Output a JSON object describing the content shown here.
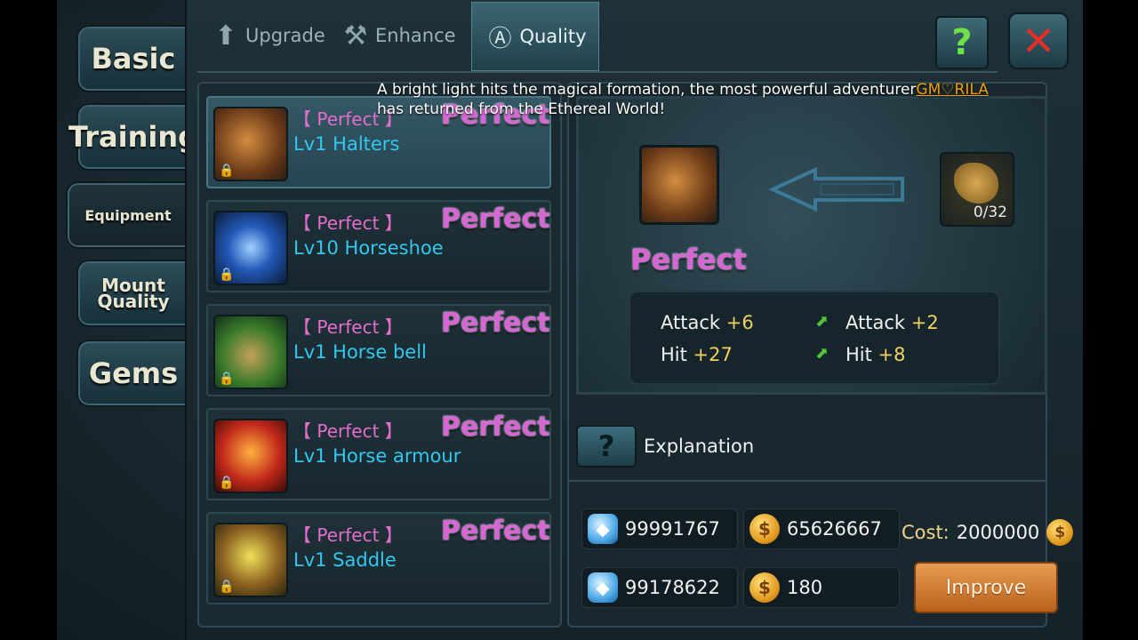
{
  "side_tabs": [
    {
      "label": "Basic"
    },
    {
      "label": "Training"
    },
    {
      "label": "Equipment"
    },
    {
      "label": "Mount Quality"
    },
    {
      "label": "Gems"
    }
  ],
  "top_tabs": [
    {
      "label": "Upgrade"
    },
    {
      "label": "Enhance"
    },
    {
      "label": "Quality"
    }
  ],
  "help_symbol": "?",
  "close_symbol": "✕",
  "announcement": {
    "prefix": "A bright light hits the magical formation, the most powerful adventurer",
    "player": "GM♡RILA",
    "suffix": " has returned from the Ethereal World!"
  },
  "items": [
    {
      "tag": "【 Perfect 】",
      "grade": "Perfect",
      "name": "Lv1 Halters"
    },
    {
      "tag": "【 Perfect 】",
      "grade": "Perfect",
      "name": "Lv10 Horseshoe"
    },
    {
      "tag": "【 Perfect 】",
      "grade": "Perfect",
      "name": "Lv1 Horse bell"
    },
    {
      "tag": "【 Perfect 】",
      "grade": "Perfect",
      "name": "Lv1 Horse armour"
    },
    {
      "tag": "【 Perfect 】",
      "grade": "Perfect",
      "name": "Lv1 Saddle"
    }
  ],
  "detail": {
    "grade": "Perfect",
    "material_count": "0/32",
    "stats_current": [
      {
        "label": "Attack",
        "value": "+6"
      },
      {
        "label": "Hit",
        "value": "+27"
      }
    ],
    "stats_bonus": [
      {
        "label": "Attack",
        "value": "+2"
      },
      {
        "label": "Hit",
        "value": "+8"
      }
    ]
  },
  "explanation": {
    "icon": "?",
    "label": "Explanation"
  },
  "resources": {
    "diamonds": "99991767",
    "gold": "65626667",
    "bound_diamonds": "99178622",
    "bound_gold": "180"
  },
  "cost": {
    "label": "Cost:",
    "value": "2000000"
  },
  "improve_label": "Improve"
}
